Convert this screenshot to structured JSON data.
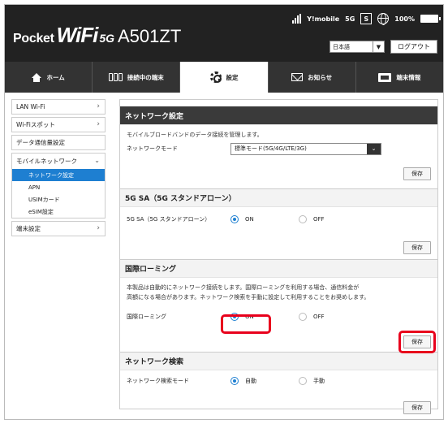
{
  "header": {
    "logo": {
      "pocket": "Pocket",
      "wifi": "WiFi",
      "g5": "5G",
      "model": "A501ZT"
    },
    "status": {
      "carrier": "Y!mobile",
      "network": "5G",
      "sim": "S",
      "battery": "100%"
    },
    "language": "日本語",
    "logout_label": "ログアウト"
  },
  "nav": {
    "tabs": [
      {
        "label": "ホーム",
        "icon": "home-icon",
        "active": false
      },
      {
        "label": "接続中の端末",
        "icon": "devices-icon",
        "active": false
      },
      {
        "label": "設定",
        "icon": "gear-icon",
        "active": true
      },
      {
        "label": "お知らせ",
        "icon": "mail-icon",
        "active": false
      },
      {
        "label": "端末情報",
        "icon": "device-info-icon",
        "active": false
      }
    ]
  },
  "sidebar": {
    "lan_wifi": "LAN Wi-Fi",
    "wifi_spot": "Wi-Fiスポット",
    "data_settings": "データ通信量設定",
    "mobile_network": "モバイルネットワーク",
    "sub_items": [
      "ネットワーク設定",
      "APN",
      "USIMカード",
      "eSIM設定"
    ],
    "device_settings": "端末設定",
    "active_sub": "ネットワーク設定"
  },
  "network_settings": {
    "title": "ネットワーク設定",
    "description": "モバイルブロードバンドのデータ接続を管理します。",
    "mode_label": "ネットワークモード",
    "mode_value": "標準モード(5G/4G/LTE/3G)",
    "save_label": "保存"
  },
  "sa_section": {
    "title": "5G SA（5G スタンドアローン）",
    "label": "5G SA（5G スタンドアローン）",
    "on_label": "ON",
    "off_label": "OFF",
    "selected": "ON",
    "save_label": "保存"
  },
  "roaming_section": {
    "title": "国際ローミング",
    "description_line1": "本製品は自動的にネットワーク接続をします。国際ローミングを利用する場合、通信料金が",
    "description_line2": "高額になる場合があります。ネットワーク検索を手動に設定して利用することをお奨めします。",
    "label": "国際ローミング",
    "on_label": "ON",
    "off_label": "OFF",
    "selected": "ON",
    "save_label": "保存"
  },
  "search_section": {
    "title": "ネットワーク検索",
    "label": "ネットワーク検索モード",
    "auto_label": "自動",
    "manual_label": "手動",
    "selected": "自動",
    "save_label": "保存"
  },
  "colors": {
    "accent": "#1e7fd1",
    "highlight": "#e8001c",
    "header_bg": "#222222",
    "nav_bg": "#333333"
  }
}
